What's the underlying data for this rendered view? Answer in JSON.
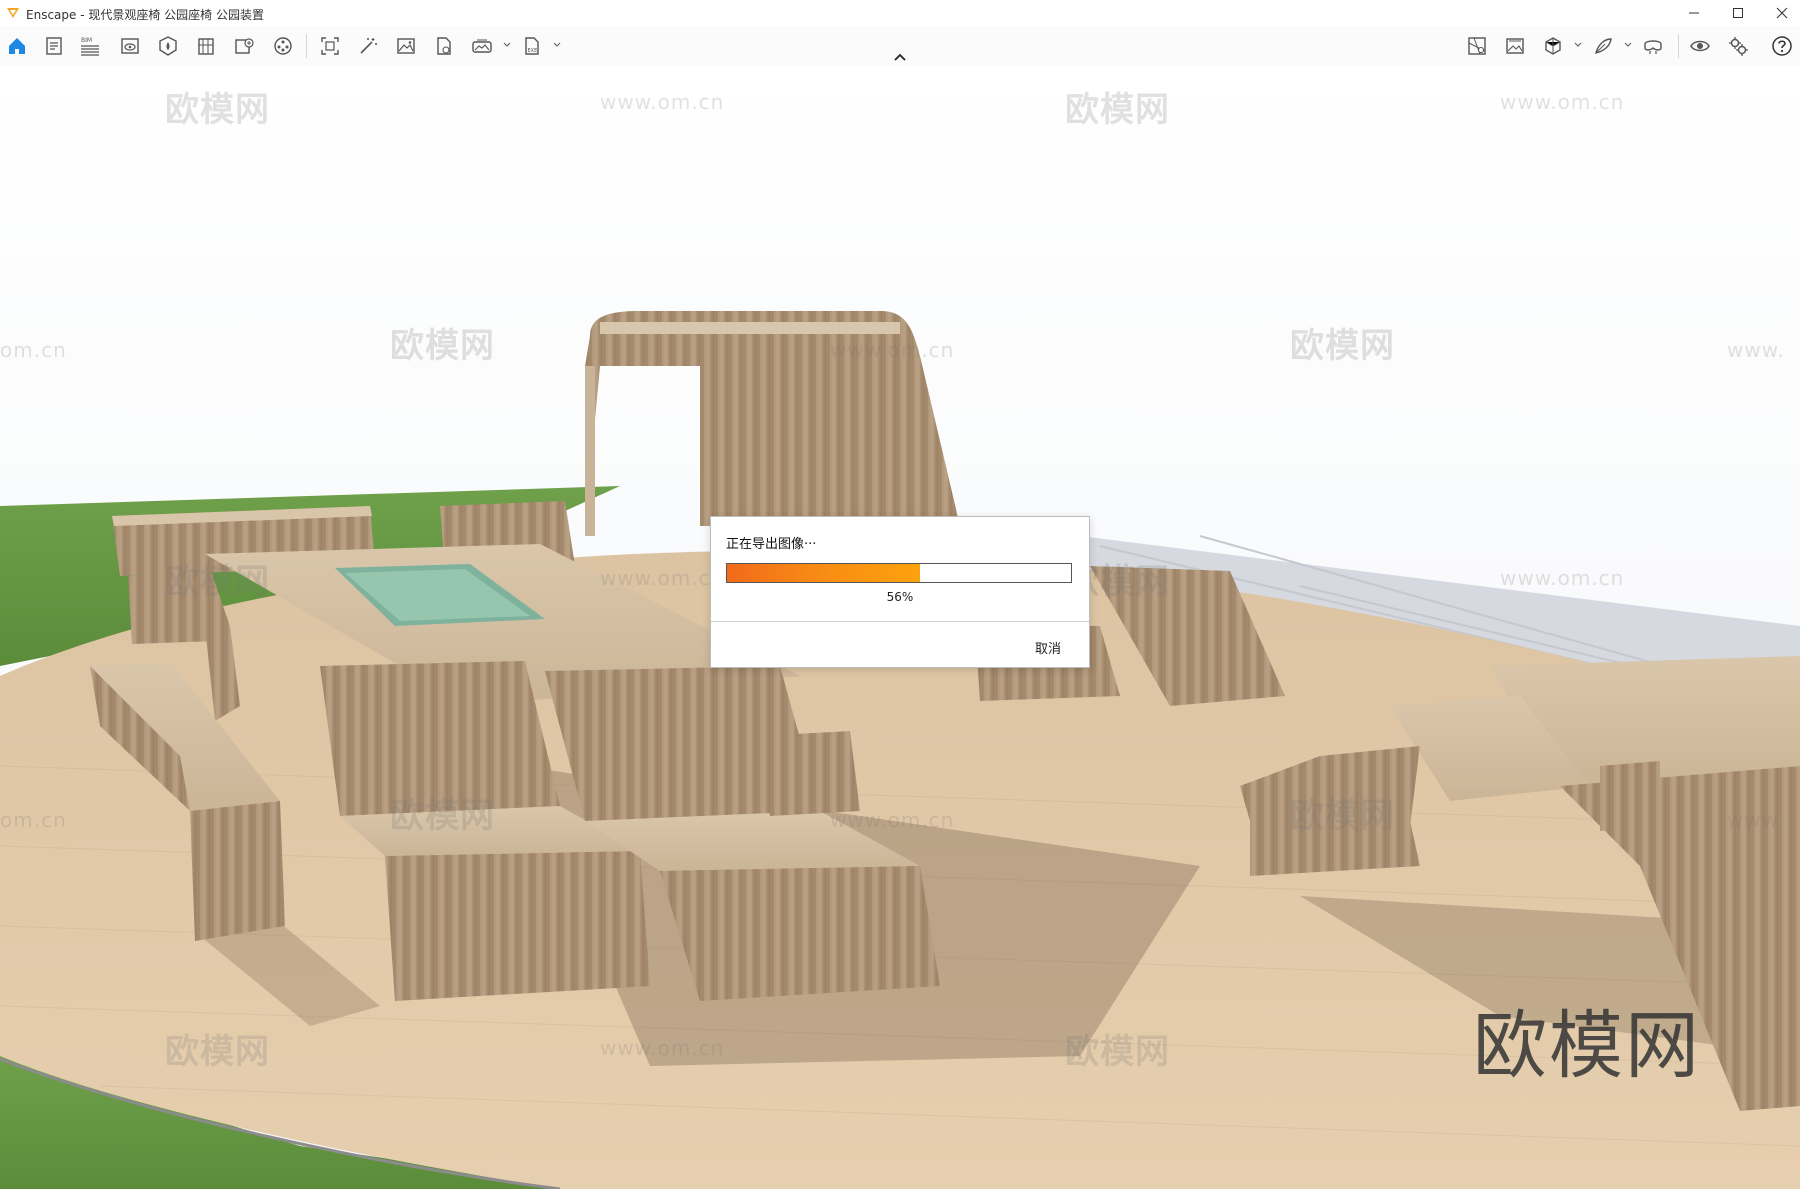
{
  "window": {
    "title": "Enscape - 现代景观座椅 公园座椅 公园装置",
    "accent_color": "#f5a623",
    "controls": [
      "minimize-icon",
      "maximize-icon",
      "close-icon"
    ]
  },
  "toolbar": {
    "left_icons": [
      "home-icon",
      "notes-icon",
      "bim-icon",
      "view-icon",
      "asset-icon",
      "building-icon",
      "export-icon",
      "video-icon",
      "screenshot-icon",
      "magic-icon",
      "image-icon",
      "file-icon",
      "panorama-icon",
      "exe-icon"
    ],
    "bim_label": "BIM",
    "exe_label": "EXE",
    "right_icons": [
      "map-icon",
      "gallery-icon",
      "section-icon",
      "feather-icon",
      "vr-icon",
      "eye-icon",
      "settings-icon",
      "help-icon"
    ],
    "home_color": "#1e88e5"
  },
  "watermarks": {
    "brand": "欧模网",
    "url": "www.om.cn",
    "url_left_fragment": "om.cn",
    "url_right_fragment": "www."
  },
  "dialog": {
    "message": "正在导出图像···",
    "progress_percent": 56,
    "progress_label": "56%",
    "cancel_label": "取消"
  }
}
